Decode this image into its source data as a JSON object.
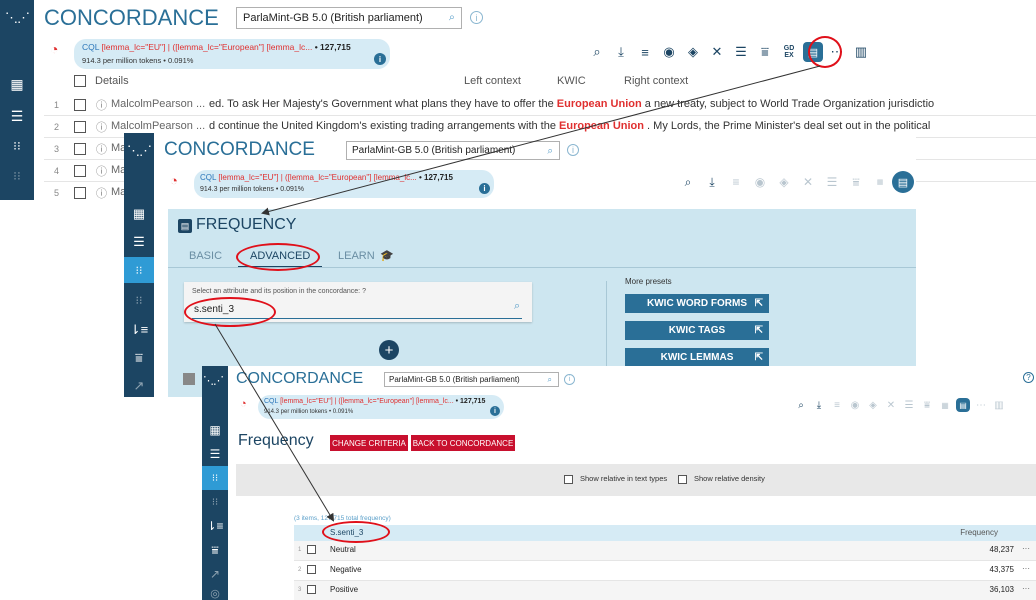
{
  "panel1": {
    "app_title": "CONCORDANCE",
    "corpus": "ParlaMint-GB 5.0 (British parliament)",
    "cql_prefix": "CQL ",
    "cql_query": "[lemma_lc=\"EU\"] | ([lemma_lc=\"European\"] [lemma_lc...",
    "cql_count": " • 127,715",
    "cql_sub": "914.3 per million tokens • 0.091%",
    "toolbar_icon_names": [
      "search-icon",
      "download-icon",
      "list-icon",
      "eye-icon",
      "tag-icon",
      "shuffle-icon",
      "sort-icon",
      "filter-icon",
      "gdex-icon",
      "frequency-icon",
      "collocation-icon",
      "chart-icon"
    ],
    "gdex_label": "GD\nEX",
    "headers": {
      "details": "Details",
      "left": "Left context",
      "kwic": "KWIC",
      "right": "Right context"
    },
    "rows": [
      {
        "n": "1",
        "name": "MalcolmPearson ...",
        "left": "ed. To ask Her Majesty's Government what plans they have to offer the ",
        "kwic": "European Union",
        "right": " a new treaty, subject to World Trade Organization jurisdictio"
      },
      {
        "n": "2",
        "name": "MalcolmPearson ...",
        "left": "d continue the United Kingdom's existing trading arrangements with the ",
        "kwic": "European Union",
        "right": " . My Lords, the Prime Minister's deal set out in the political"
      },
      {
        "n": "3",
        "name": "Ma",
        "left": "",
        "kwic": "",
        "right": ""
      },
      {
        "n": "4",
        "name": "Ma",
        "left": "",
        "kwic": "",
        "right": ""
      },
      {
        "n": "5",
        "name": "Ma",
        "left": "",
        "kwic": "",
        "right": ""
      }
    ]
  },
  "panel2": {
    "app_title": "CONCORDANCE",
    "corpus": "ParlaMint-GB 5.0 (British parliament)",
    "cql_prefix": "CQL ",
    "cql_query": "[lemma_lc=\"EU\"] | ([lemma_lc=\"European\"] [lemma_lc...",
    "cql_count": " • 127,715",
    "cql_sub": "914.3 per million tokens • 0.091%",
    "freq_title": "FREQUENCY",
    "tabs": [
      "BASIC",
      "ADVANCED",
      "LEARN"
    ],
    "attr_label": "Select an attribute and its position in the concordance: ",
    "attr_help": "?",
    "attr_value": "s.senti_3",
    "more_presets": "More presets",
    "presets": [
      "KWIC WORD FORMS",
      "KWIC TAGS",
      "KWIC LEMMAS"
    ]
  },
  "panel3": {
    "app_title": "CONCORDANCE",
    "corpus": "ParlaMint-GB 5.0 (British parliament)",
    "cql_prefix": "CQL ",
    "cql_query": "[lemma_lc=\"EU\"] | ([lemma_lc=\"European\"] [lemma_lc...",
    "cql_count": " • 127,715",
    "cql_sub": "914.3 per million tokens • 0.091%",
    "heading": "Frequency",
    "change_criteria": "CHANGE CRITERIA",
    "back": "BACK TO CONCORDANCE",
    "show_rel_text": "Show relative in text types",
    "show_rel_density": "Show relative density",
    "summary": "(3 items, 127,715 total frequency)",
    "col_attr": "S.senti_3",
    "col_freq": "Frequency",
    "rows": [
      {
        "n": "1",
        "label": "Neutral",
        "value": "48,237",
        "more": "···"
      },
      {
        "n": "2",
        "label": "Negative",
        "value": "43,375",
        "more": "···"
      },
      {
        "n": "3",
        "label": "Positive",
        "value": "36,103",
        "more": "···"
      }
    ],
    "help": "?"
  },
  "colors": {
    "navy": "#1c4563",
    "accent": "#2f9bd5",
    "brand": "#2a6f97",
    "keyword": "#e03030",
    "annotation": "#e0101a",
    "panel_bg": "#cde6f0"
  }
}
